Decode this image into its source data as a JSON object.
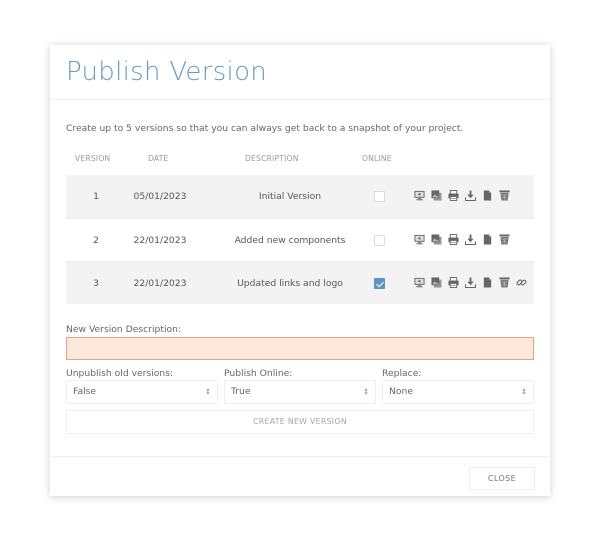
{
  "dialog": {
    "title": "Publish Version",
    "intro": "Create up to 5 versions so that you can always get back to a snapshot of your project."
  },
  "table": {
    "headers": {
      "version": "VERSION",
      "date": "DATE",
      "description": "DESCRIPTION",
      "online": "ONLINE"
    },
    "rows": [
      {
        "version": "1",
        "date": "05/01/2023",
        "description": "Initial Version",
        "online": false,
        "actions": [
          "share-screen-icon",
          "copy-images-icon",
          "print-icon",
          "download-icon",
          "document-icon",
          "trash-icon"
        ]
      },
      {
        "version": "2",
        "date": "22/01/2023",
        "description": "Added new components",
        "online": false,
        "actions": [
          "share-screen-icon",
          "copy-images-icon",
          "print-icon",
          "download-icon",
          "document-icon",
          "trash-icon"
        ]
      },
      {
        "version": "3",
        "date": "22/01/2023",
        "description": "Updated links and logo",
        "online": true,
        "actions": [
          "share-screen-icon",
          "copy-images-icon",
          "print-icon",
          "download-icon",
          "document-icon",
          "trash-icon",
          "link-icon"
        ]
      }
    ]
  },
  "form": {
    "description_label": "New Version Description:",
    "description_value": "",
    "unpublish_label": "Unpublish old versions:",
    "unpublish_value": "False",
    "publish_online_label": "Publish Online:",
    "publish_online_value": "True",
    "replace_label": "Replace:",
    "replace_value": "None",
    "create_button": "CREATE NEW VERSION"
  },
  "footer": {
    "close_button": "CLOSE"
  },
  "colors": {
    "title": "#6a9bbb",
    "checkbox_checked": "#5f95c2",
    "input_bg": "#fde9dc",
    "input_border": "#e9a37c",
    "row_shade": "#f3f3f3"
  }
}
